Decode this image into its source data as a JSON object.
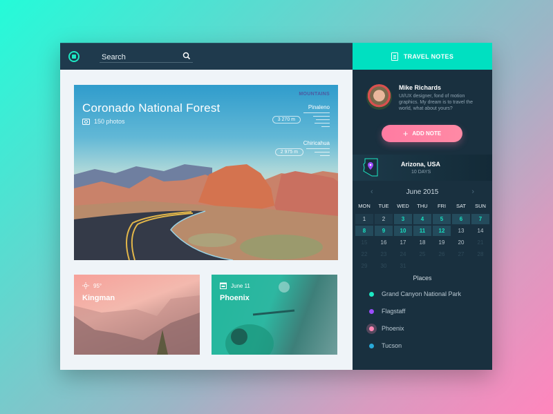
{
  "topbar": {
    "search_placeholder": "Search",
    "logo_icon": "app-logo-icon",
    "search_icon": "search-icon"
  },
  "hero": {
    "title": "Coronado National Forest",
    "photos": "150 photos",
    "mountains_heading": "MOUNTAINS",
    "mountains": [
      {
        "name": "Pinaleno",
        "elevation": "3 270 m"
      },
      {
        "name": "Chiricahua",
        "elevation": "2 975 m"
      }
    ]
  },
  "cards": [
    {
      "meta_icon": "sun-icon",
      "meta": "95°",
      "title": "Kingman"
    },
    {
      "meta_icon": "calendar-icon",
      "meta": "June 11",
      "title": "Phoenix"
    }
  ],
  "sidebar": {
    "header": "TRAVEL NOTES",
    "profile": {
      "name": "Mike Richards",
      "bio": "UI/UX designer, fond of motion graphics. My dream is to travel the world, what about yours?"
    },
    "add_note": "ADD NOTE",
    "region": {
      "name": "Arizona, USA",
      "days": "10 DAYS"
    },
    "calendar": {
      "month": "June 2015",
      "weekdays": [
        "MON",
        "TUE",
        "WED",
        "THU",
        "FRI",
        "SAT",
        "SUN"
      ],
      "weeks": [
        [
          {
            "d": "1",
            "s": "normal"
          },
          {
            "d": "2",
            "s": "normal"
          },
          {
            "d": "3",
            "s": "sel"
          },
          {
            "d": "4",
            "s": "sel"
          },
          {
            "d": "5",
            "s": "sel"
          },
          {
            "d": "6",
            "s": "sel"
          },
          {
            "d": "7",
            "s": "sel"
          }
        ],
        [
          {
            "d": "8",
            "s": "sel"
          },
          {
            "d": "9",
            "s": "sel"
          },
          {
            "d": "10",
            "s": "sel"
          },
          {
            "d": "11",
            "s": "sel"
          },
          {
            "d": "12",
            "s": "sel"
          },
          {
            "d": "13",
            "s": "plain"
          },
          {
            "d": "14",
            "s": "plain"
          }
        ],
        [
          {
            "d": "15",
            "s": "dim"
          },
          {
            "d": "16",
            "s": "plain"
          },
          {
            "d": "17",
            "s": "plain"
          },
          {
            "d": "18",
            "s": "plain"
          },
          {
            "d": "19",
            "s": "plain"
          },
          {
            "d": "20",
            "s": "plain"
          },
          {
            "d": "21",
            "s": "dim"
          }
        ],
        [
          {
            "d": "22",
            "s": "dim"
          },
          {
            "d": "23",
            "s": "dim"
          },
          {
            "d": "24",
            "s": "dim"
          },
          {
            "d": "25",
            "s": "dim"
          },
          {
            "d": "26",
            "s": "dim"
          },
          {
            "d": "27",
            "s": "dim"
          },
          {
            "d": "28",
            "s": "dim"
          }
        ],
        [
          {
            "d": "29",
            "s": "dim"
          },
          {
            "d": "30",
            "s": "dim"
          },
          {
            "d": "31",
            "s": "dim"
          }
        ]
      ]
    },
    "places_title": "Places",
    "places": [
      {
        "name": "Grand Canyon National Park",
        "color": "#1de9c4"
      },
      {
        "name": "Flagstaff",
        "color": "#9b4dff"
      },
      {
        "name": "Phoenix",
        "color": "#ff86b4"
      },
      {
        "name": "Tucson",
        "color": "#29a9d9"
      }
    ]
  }
}
